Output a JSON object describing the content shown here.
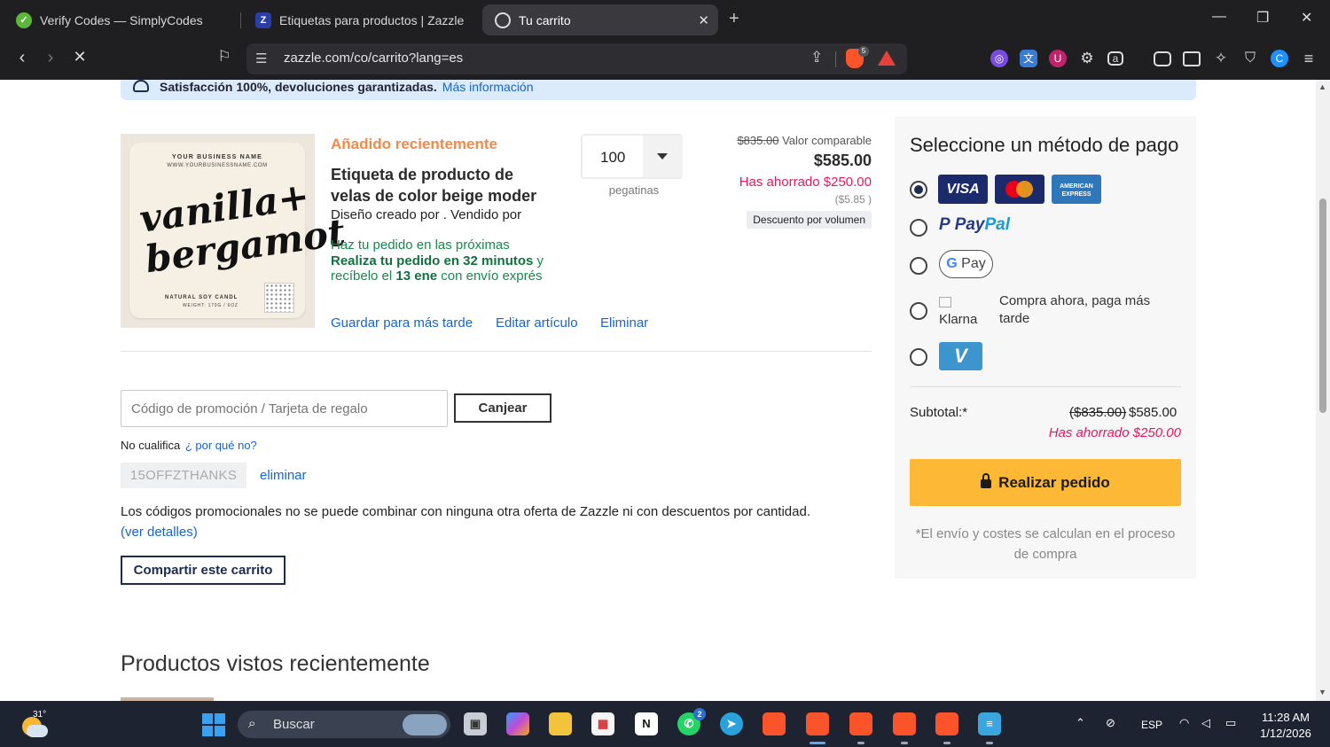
{
  "browser": {
    "tabs": [
      {
        "title": "Verify Codes — SimplyCodes",
        "active": false
      },
      {
        "title": "Etiquetas para productos | Zazzle",
        "active": false
      },
      {
        "title": "Tu carrito",
        "active": true
      }
    ],
    "url": "zazzle.com/co/carrito?lang=es",
    "brave_badge": "5"
  },
  "banner": {
    "text": "Satisfacción 100%, devoluciones garantizadas.",
    "link": "Más información"
  },
  "product": {
    "image_label": {
      "business_name": "YOUR BUSINESS NAME",
      "business_url": "WWW.YOURBUSINESSNAME.COM",
      "script_line1": "vanilla+",
      "script_line2": "bergamot",
      "subtitle": "NATURAL SOY CANDL",
      "weight": "WEIGHT: 170G / 6OZ"
    },
    "recently_added": "Añadido recientemente",
    "title": "Etiqueta de producto de velas de color beige moder",
    "designed_by": "Diseño creado por . Vendido por",
    "delivery_line1": "Haz tu pedido en las próximas",
    "delivery_bold1": "Realiza tu pedido en 32 minutos",
    "delivery_and": " y",
    "delivery_line3a": "recíbelo el ",
    "delivery_bold2": "13 ene",
    "delivery_line3b": " con envío exprés",
    "save_later": "Guardar para más tarde",
    "edit": "Editar artículo",
    "remove": "Eliminar",
    "quantity": "100",
    "quantity_unit": "pegatinas",
    "compare_price": "$835.00",
    "compare_label": "Valor comparable",
    "price": "$585.00",
    "saved": "Has ahorrado $250.00",
    "unit_price": "($5.85 )",
    "volume_discount": "Descuento por volumen"
  },
  "promo": {
    "placeholder": "Código de promoción / Tarjeta de regalo",
    "redeem": "Canjear",
    "not_qualified": "No cualifica",
    "why": "¿ por qué no?",
    "code": "15OFFZTHANKS",
    "code_remove": "eliminar",
    "note": "Los códigos promocionales no se puede combinar con ninguna otra oferta de Zazzle ni con descuentos por cantidad.",
    "details": "(ver detalles)",
    "share_cart": "Compartir este carrito"
  },
  "recent_products_title": "Productos vistos recientemente",
  "payment": {
    "title": "Seleccione un método de pago",
    "selected": "cards",
    "visa": "VISA",
    "amex": "AMERICAN EXPRESS",
    "paypal_a": "Pay",
    "paypal_b": "Pal",
    "gpay": "Pay",
    "klarna": "Klarna",
    "klarna_text": "Compra ahora, paga más tarde",
    "venmo": "V",
    "subtotal_label": "Subtotal:*",
    "subtotal_old": "($835.00)",
    "subtotal_new": "$585.00",
    "subtotal_saved": "Has ahorrado $250.00",
    "place_order": "Realizar pedido",
    "shipping_note": "*El envío y costes se calculan en el proceso de compra"
  },
  "taskbar": {
    "temperature": "31°",
    "search": "Buscar",
    "whatsapp_badge": "2",
    "language": "ESP",
    "time": "11:28 AM",
    "date": "1/12/2026"
  },
  "colors": {
    "accent_orange": "#f08a4b",
    "link_blue": "#1865c7",
    "savings_pink": "#e8175d",
    "order_button": "#fdb936",
    "delivery_green": "#188a4b"
  }
}
